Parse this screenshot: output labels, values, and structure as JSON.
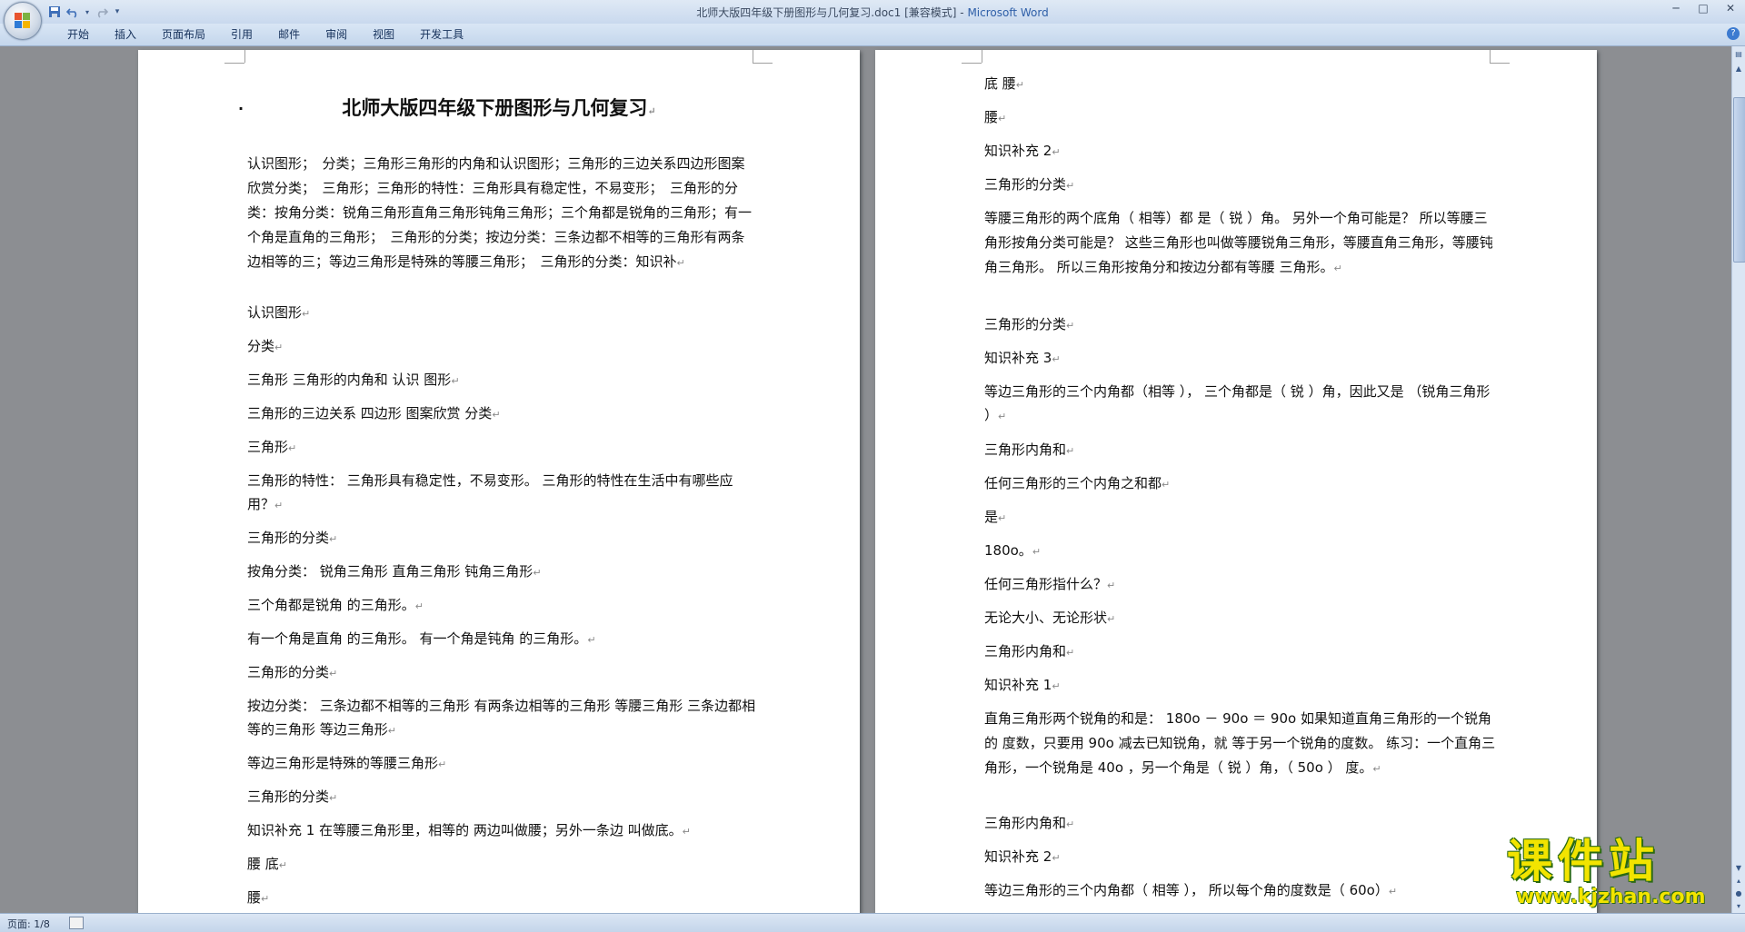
{
  "window": {
    "title": "北师大版四年级下册图形与几何复习.doc1 [兼容模式] - ",
    "app_name": "Microsoft Word"
  },
  "ribbon": {
    "tabs": [
      "开始",
      "插入",
      "页面布局",
      "引用",
      "邮件",
      "审阅",
      "视图",
      "开发工具"
    ]
  },
  "icons": {
    "office": "office-logo-icon",
    "save": "save-icon",
    "undo": "undo-icon",
    "redo": "redo-icon",
    "customize": "chevron-down-icon",
    "help": "help-icon"
  },
  "page1": {
    "title": "北师大版四年级下册图形与几何复习",
    "paragraphs": [
      "认识图形；　分类；三角形三角形的内角和认识图形；三角形的三边关系四边形图案欣赏分类；　三角形；三角形的特性：三角形具有稳定性，不易变形；　三角形的分类：按角分类：锐角三角形直角三角形钝角三角形；三个角都是锐角的三角形；有一个角是直角的三角形；　三角形的分类；按边分类：三条边都不相等的三角形有两条边相等的三；等边三角形是特殊的等腰三角形；　三角形的分类：知识补",
      "认识图形",
      "分类",
      "三角形 三角形的内角和 认识 图形",
      "三角形的三边关系 四边形 图案欣赏 分类",
      "三角形",
      "三角形的特性： 三角形具有稳定性，不易变形。 三角形的特性在生活中有哪些应用？",
      "三角形的分类",
      "按角分类： 锐角三角形 直角三角形 钝角三角形",
      "三个角都是锐角 的三角形。",
      "有一个角是直角 的三角形。 有一个角是钝角 的三角形。",
      "三角形的分类",
      "按边分类： 三条边都不相等的三角形 有两条边相等的三角形 等腰三角形 三条边都相等的三角形 等边三角形",
      "等边三角形是特殊的等腰三角形",
      "三角形的分类",
      "知识补充 1 在等腰三角形里，相等的 两边叫做腰；另外一条边 叫做底。",
      "腰 底",
      "腰"
    ]
  },
  "page2": {
    "paragraphs": [
      "底 腰",
      "腰",
      "知识补充 2",
      "三角形的分类",
      "等腰三角形的两个底角（ 相等）都 是（ 锐 ）角。 另外一个角可能是？ 所以等腰三角形按角分类可能是？ 这些三角形也叫做等腰锐角三角形，等腰直角三角形，等腰钝角三角形。 所以三角形按角分和按边分都有等腰 三角形。",
      "三角形的分类",
      "知识补充 3",
      "等边三角形的三个内角都（相等 ）， 三个角都是（ 锐 ）角，因此又是 （锐角三角形 ）",
      "三角形内角和",
      "任何三角形的三个内角之和都",
      "是",
      "180o。",
      "任何三角形指什么？",
      "无论大小、无论形状",
      "三角形内角和",
      "知识补充 1",
      "直角三角形两个锐角的和是： 180o － 90o ＝ 90o 如果知道直角三角形的一个锐角的 度数，只要用 90o 减去已知锐角，就 等于另一个锐角的度数。 练习：一个直角三角形，一个锐角是 40o ，另一个角是（ 锐 ）角，（ 50o ） 度。",
      "三角形内角和",
      "知识补充 2",
      "等边三角形的三个内角都（ 相等 ）， 所以每个角的度数是（ 60o）"
    ]
  },
  "status": {
    "page": "页面: 1/8"
  },
  "watermark": {
    "main": "课件站",
    "url": "www.kjzhan.com"
  },
  "colors": {
    "titlebar": "#dfe9f5",
    "ribbon": "#c4d6ec",
    "workspace": "#8c8e92",
    "watermark": "#f2e400"
  }
}
